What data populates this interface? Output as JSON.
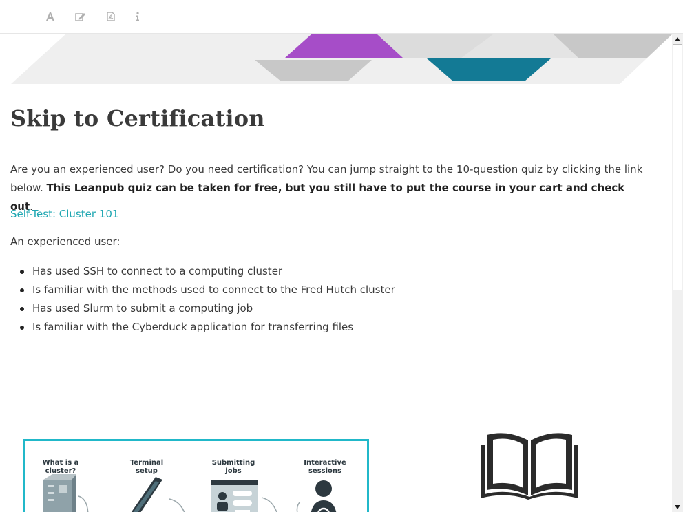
{
  "toolbar": {
    "buttons": [
      {
        "name": "font-icon",
        "glyph": "A"
      },
      {
        "name": "edit-icon",
        "glyph": "✎"
      },
      {
        "name": "pdf-icon",
        "glyph": "pdf"
      },
      {
        "name": "info-icon",
        "glyph": "i"
      }
    ]
  },
  "banner": {
    "colors": {
      "purple": "#a64dc8",
      "teal": "#137a95",
      "grey": "#c8c8c8",
      "light": "#ececec"
    }
  },
  "page": {
    "title": "Skip to Certification",
    "para_text": "Are you an experienced user? Do you need certification? You can jump straight to the 10-question quiz by clicking the link below. ",
    "para_bold": "This Leanpub quiz can be taken for free, but you still have to put the course in your cart and check out",
    "para_end": ".",
    "quiz_link": "Self-Test: Cluster 101",
    "intro": "An experienced user:",
    "bullets": [
      "Has used SSH to connect to a computing cluster",
      "Is familiar with the methods used to connect to the Fred Hutch cluster",
      "Has used Slurm to submit a computing job",
      "Is familiar with the Cyberduck application for transferring files"
    ]
  },
  "diagram": {
    "steps": [
      {
        "line1": "What is a",
        "line2": "cluster?"
      },
      {
        "line1": "Terminal",
        "line2": "setup"
      },
      {
        "line1": "Submitting",
        "line2": "jobs"
      },
      {
        "line1": "Interactive",
        "line2": "sessions"
      }
    ],
    "accent": "#21b8c9"
  }
}
